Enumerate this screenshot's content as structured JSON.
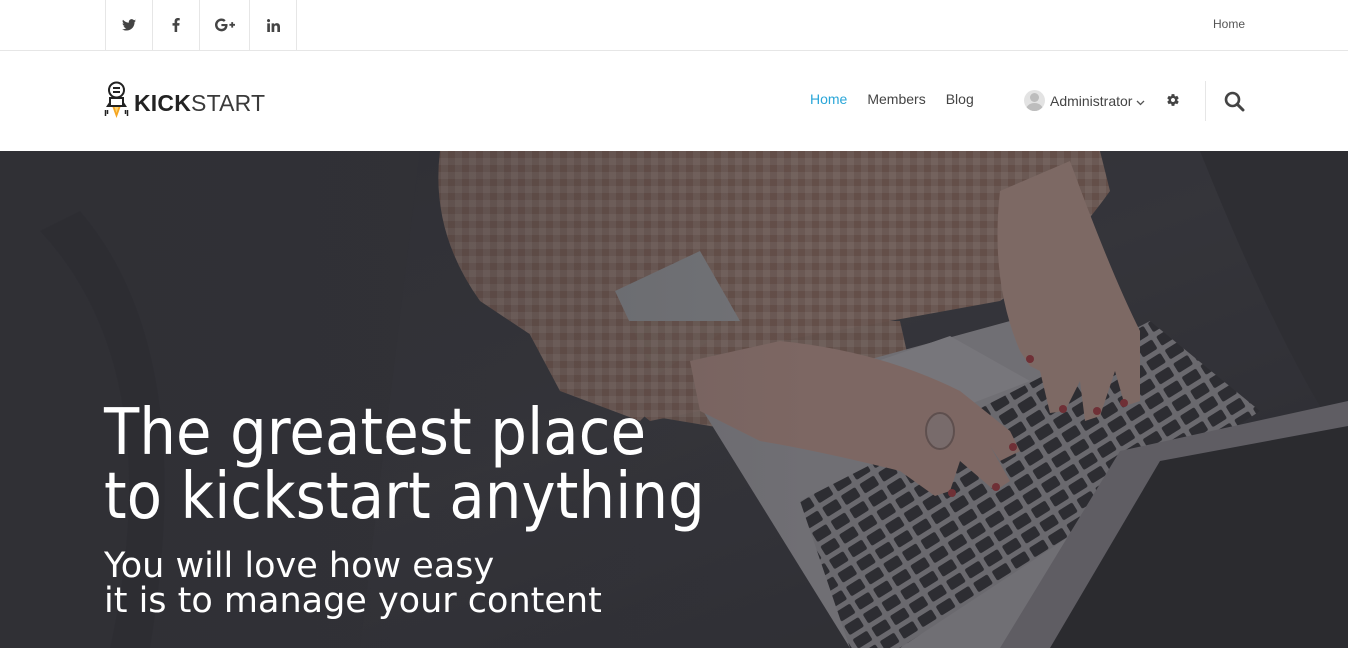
{
  "topbar": {
    "social": [
      {
        "icon": "twitter-icon",
        "glyph": "twitter"
      },
      {
        "icon": "facebook-icon",
        "glyph": "f"
      },
      {
        "icon": "google-plus-icon",
        "glyph": "G+"
      },
      {
        "icon": "linkedin-icon",
        "glyph": "in"
      }
    ],
    "breadcrumb_home": "Home"
  },
  "header": {
    "logo": {
      "kick": "KICK",
      "start": "START",
      "icon": "rocket-lightbulb-icon"
    },
    "nav": [
      {
        "label": "Home",
        "active": true
      },
      {
        "label": "Members",
        "active": false
      },
      {
        "label": "Blog",
        "active": false
      }
    ],
    "user": {
      "name": "Administrator",
      "icon": "avatar-icon"
    },
    "settings_icon": "gear-icon",
    "search_icon": "search-icon"
  },
  "hero": {
    "title_line1": "The greatest place",
    "title_line2": "to kickstart anything",
    "subtitle_line1": "You will love how easy",
    "subtitle_line2": "it is to manage your content"
  },
  "colors": {
    "accent": "#2aa6d8",
    "text": "#444444",
    "hero_overlay": "#3b3b40"
  }
}
